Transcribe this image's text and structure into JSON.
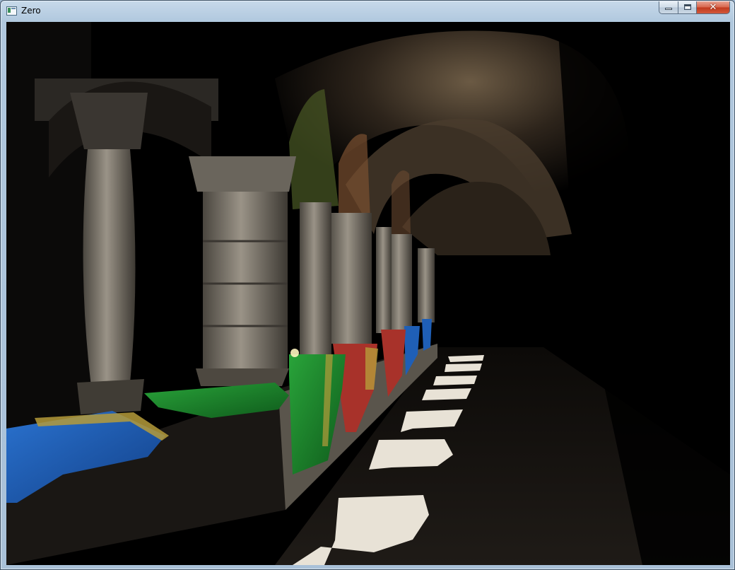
{
  "window": {
    "title": "Zero",
    "buttons": {
      "minimize": "minimize",
      "maximize": "maximize",
      "close": "✕"
    }
  },
  "scene": {
    "description_icon": "render-viewport",
    "colors": {
      "stone_light": "#8c857b",
      "stone_dark": "#3a3631",
      "cloth_blue": "#1f5fb6",
      "cloth_green": "#1e8a2e",
      "cloth_red": "#a8322a",
      "cloth_yellow": "#b59b3a",
      "sunlight": "#e8e2d6"
    }
  }
}
